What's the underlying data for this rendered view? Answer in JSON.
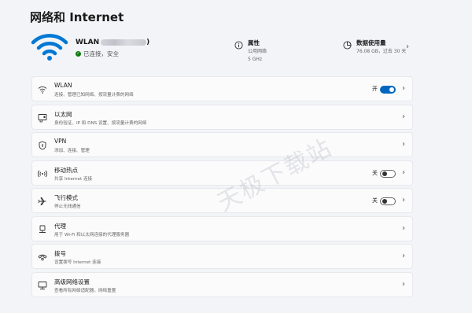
{
  "header": {
    "title": "网络和 Internet"
  },
  "connection": {
    "name": "WLAN",
    "paren": ")",
    "status": "已连接，安全",
    "status_color": "#0f7b0f",
    "icon": "wifi-icon"
  },
  "properties": {
    "title": "属性",
    "line1": "公用网络",
    "line2": "5 GHz",
    "icon": "info-icon"
  },
  "data_usage": {
    "title": "数据使用量",
    "line1": "76.08 GB，过去 30 天",
    "icon": "pie-chart-icon"
  },
  "items": [
    {
      "title": "WLAN",
      "sub": "连接、管理已知网络、按流量计费的网络",
      "toggle_label": "开",
      "toggle_on": true,
      "icon": "wifi-icon"
    },
    {
      "title": "以太网",
      "sub": "身份验证、IP 和 DNS 设置、按流量计费的网络",
      "icon": "ethernet-icon"
    },
    {
      "title": "VPN",
      "sub": "添加、连接、管理",
      "icon": "shield-icon"
    },
    {
      "title": "移动热点",
      "sub": "共享 Internet 连接",
      "toggle_label": "关",
      "toggle_on": false,
      "icon": "hotspot-icon"
    },
    {
      "title": "飞行模式",
      "sub": "停止无线通信",
      "toggle_label": "关",
      "toggle_on": false,
      "icon": "airplane-icon"
    },
    {
      "title": "代理",
      "sub": "用于 Wi-Fi 和以太网连接的代理服务器",
      "icon": "proxy-icon"
    },
    {
      "title": "拨号",
      "sub": "设置拨号 Internet 连接",
      "icon": "dialup-icon"
    },
    {
      "title": "高级网络设置",
      "sub": "查看所有网络适配器，网络重置",
      "icon": "monitor-network-icon"
    }
  ],
  "watermark": "天极下载站",
  "accent": "#0067c0"
}
